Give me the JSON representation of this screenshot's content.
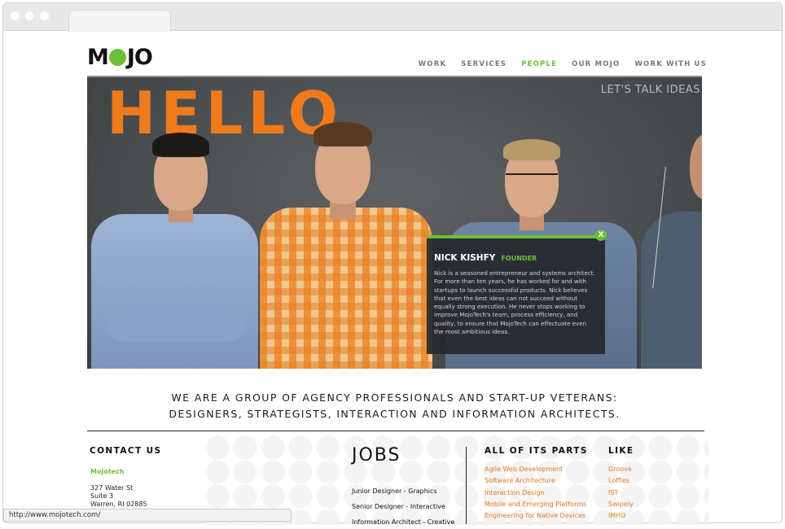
{
  "brand": {
    "logo_left": "M",
    "logo_right": "J",
    "logo_end": "O",
    "accent": "#6cbf36",
    "orange": "#ef7a1c"
  },
  "nav": [
    {
      "label": "WORK",
      "active": false
    },
    {
      "label": "SERVICES",
      "active": false
    },
    {
      "label": "PEOPLE",
      "active": true
    },
    {
      "label": "OUR MOJO",
      "active": false
    },
    {
      "label": "WORK WITH US",
      "active": false
    }
  ],
  "hero": {
    "headline": "HELLO",
    "cta": "LET'S TALK IDEAS"
  },
  "card": {
    "close": "X",
    "name": "NICK KISHFY",
    "role": "FOUNDER",
    "bio": "Nick is a seasoned entrepreneur and systems architect. For more than ten years, he has worked for and with startups to launch successful products. Nick believes that even the best ideas can not succeed without equally strong execution. He never stops working to improve MojoTech's team, process efficiency, and quality, to ensure that MojoTech can effectuate even the most ambitious ideas."
  },
  "tagline": {
    "line1": "WE ARE A GROUP OF AGENCY PROFESSIONALS AND START-UP VETERANS:",
    "line2": "DESIGNERS, STRATEGISTS, INTERACTION AND INFORMATION ARCHITECTS."
  },
  "contact": {
    "heading": "CONTACT US",
    "company": "Mojotech",
    "address": [
      "327 Water St",
      "Suite 3",
      "Warren, RI 02885"
    ]
  },
  "jobs": {
    "heading": "JOBS",
    "items": [
      "Junior Designer - Graphics",
      "Senior Designer - Interactive",
      "Information Architect - Creative"
    ]
  },
  "parts": {
    "heading": "ALL OF ITS PARTS",
    "items": [
      "Agile Web Development",
      "Software Architecture",
      "Interaction Design",
      "Mobile and Emerging Platforms",
      "Engineering for Native Devices"
    ]
  },
  "like": {
    "heading": "LIKE",
    "items": [
      "Groove",
      "Loffles",
      "IST",
      "Swipely",
      "IMHO"
    ]
  },
  "status_bar": {
    "url": "http://www.mojotech.com/"
  }
}
